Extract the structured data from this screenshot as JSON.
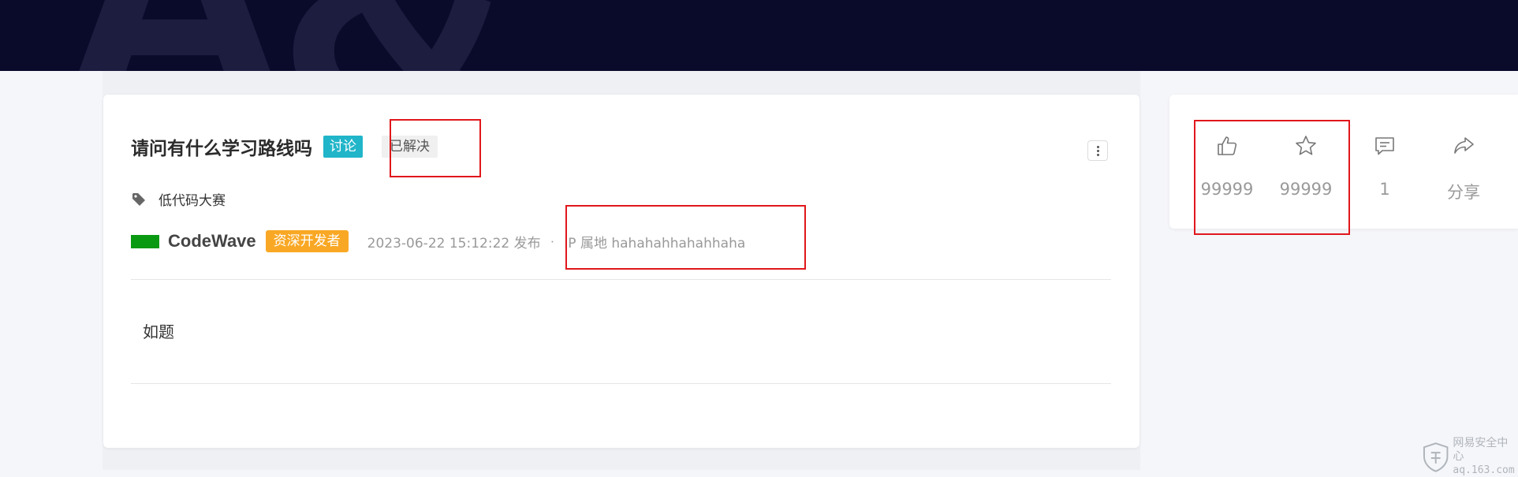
{
  "banner": {
    "decoration_text": "A&"
  },
  "post": {
    "title": "请问有什么学习路线吗",
    "type_tag": "讨论",
    "status_tag": "已解决",
    "topic": "低代码大赛",
    "author": {
      "name": "CodeWave",
      "badge": "资深开发者",
      "avatar_color": "#0a9a12"
    },
    "date": "2023-06-22 15:12:22 发布",
    "separator": "·",
    "ip_location": "IP 属地 hahahahhahahhaha",
    "body": "如题"
  },
  "actions": {
    "like": {
      "icon": "thumbs-up-icon",
      "count": "99999"
    },
    "favorite": {
      "icon": "star-icon",
      "count": "99999"
    },
    "comment": {
      "icon": "comment-icon",
      "count": "1"
    },
    "share": {
      "icon": "share-icon",
      "label": "分享"
    }
  },
  "watermark": {
    "line1": "网易安全中心",
    "line2": "aq.163.com"
  },
  "colors": {
    "banner_bg": "#0a0b2b",
    "tag_discuss": "#20b5c9",
    "badge_orange": "#f9a825",
    "annotation_red": "#e0171b"
  }
}
